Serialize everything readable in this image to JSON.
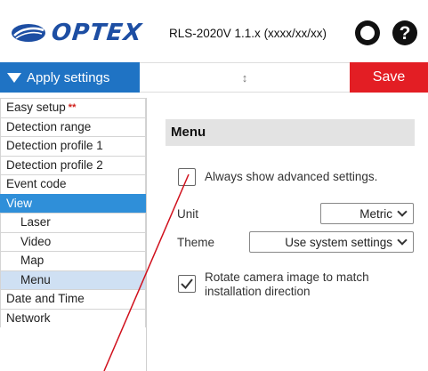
{
  "header": {
    "brand": "OPTEX",
    "version": "RLS-2020V 1.1.x (xxxx/xx/xx)",
    "icons": [
      "user-icon",
      "help-icon"
    ]
  },
  "toolbar": {
    "apply_label": "Apply settings",
    "resize_glyph": "↕",
    "save_label": "Save"
  },
  "sidebar": {
    "items": [
      {
        "label": "Easy setup",
        "marker": "**"
      },
      {
        "label": "Detection range"
      },
      {
        "label": "Detection profile 1"
      },
      {
        "label": "Detection profile 2"
      },
      {
        "label": "Event code"
      },
      {
        "label": "View"
      },
      {
        "label": "Laser"
      },
      {
        "label": "Video"
      },
      {
        "label": "Map"
      },
      {
        "label": "Menu"
      },
      {
        "label": "Date and Time"
      },
      {
        "label": "Network"
      }
    ]
  },
  "main": {
    "title": "Menu",
    "advanced": {
      "label": "Always show advanced settings.",
      "checked": false
    },
    "unit": {
      "label": "Unit",
      "value": "Metric"
    },
    "theme": {
      "label": "Theme",
      "value": "Use system settings"
    },
    "rotate": {
      "label": "Rotate camera image to match installation direction",
      "checked": true
    }
  },
  "colors": {
    "brand": "#1d4ea3",
    "apply": "#1f73c4",
    "save": "#e31e24",
    "nav_active": "#2f8fd9",
    "nav_selected": "#cfe0f3",
    "annotation": "#d0101c"
  }
}
